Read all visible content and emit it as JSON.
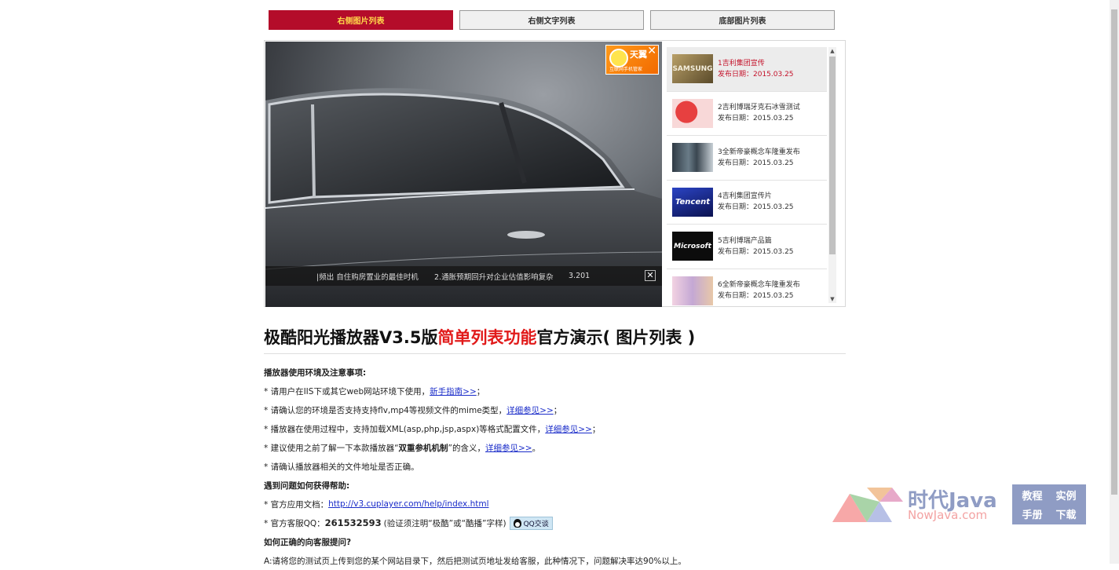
{
  "tabs": [
    {
      "label": "右侧图片列表",
      "active": true
    },
    {
      "label": "右侧文字列表",
      "active": false
    },
    {
      "label": "底部图片列表",
      "active": false
    }
  ],
  "ad": {
    "text": "天翼",
    "sub": "互联网手机管家",
    "close": "✕"
  },
  "ticker": {
    "items": [
      "|频出 自住购房置业的最佳时机",
      "2.通胀预期回升对企业估值影响复杂",
      "3.201"
    ],
    "close": "✕"
  },
  "playlist": [
    {
      "title": "1吉利集团宣传",
      "date": "发布日期：2015.03.25",
      "thumb_color": "#8a7a4a",
      "thumb_text": "SAMSUNG"
    },
    {
      "title": "2吉利博瑞牙克石冰雪测试",
      "date": "发布日期：2015.03.25",
      "thumb_color": "#e13c3c",
      "thumb_text": ""
    },
    {
      "title": "3全新帝豪概念车隆重发布",
      "date": "发布日期：2015.03.25",
      "thumb_color": "#3d4a52",
      "thumb_text": ""
    },
    {
      "title": "4吉利集团宣传片",
      "date": "发布日期：2015.03.25",
      "thumb_color": "#1d2f8a",
      "thumb_text": "Tencent"
    },
    {
      "title": "5吉利博瑞产品篇",
      "date": "发布日期：2015.03.25",
      "thumb_color": "#111111",
      "thumb_text": "Microsoft"
    },
    {
      "title": "6全新帝豪概念车隆重发布",
      "date": "发布日期：2015.03.25",
      "thumb_color": "#c4a8d4",
      "thumb_text": ""
    }
  ],
  "headline": {
    "part1": "极酷阳光播放器V3.5版",
    "part2": "简单列表功能",
    "part3": "官方演示( 图片列表 )"
  },
  "notes": {
    "env_title": "播放器使用环境及注意事项:",
    "l1_text": "* 请用户在IIS下或其它web网站环境下使用，",
    "l1_link": "新手指南>>",
    "l1_end": "；",
    "l2_text": "* 请确认您的环境是否支持支持flv,mp4等视频文件的mime类型，",
    "l2_link": "详细参见>>",
    "l2_end": "；",
    "l3_text": "* 播放器在使用过程中，支持加载XML(asp,php,jsp,aspx)等格式配置文件，",
    "l3_link": "详细参见>>",
    "l3_end": "；",
    "l4_text": "* 建议使用之前了解一下本款播放器“",
    "l4_bold": "双重参机机制",
    "l4_mid": "”的含义，",
    "l4_link": "详细参见>>",
    "l4_end": "。",
    "l5_text": "* 请确认播放器相关的文件地址是否正确。",
    "help_title": "遇到问题如何获得帮助:",
    "doc_text": "* 官方应用文档：",
    "doc_link": "http://v3.cuplayer.com/help/index.html",
    "qq_text": "* 官方客服QQ：",
    "qq_number": "261532593",
    "qq_note": "(验证须注明“极酷”或“酷播”字样)",
    "qq_button": "QQ交谈",
    "ask_title": "如何正确的向客服提问?",
    "ask_text": "A:请将您的测试页上传到您的某个网站目录下，然后把测试页地址发给客服，此种情况下，问题解决率达90%以上。"
  },
  "watermark": {
    "brand": "时代Java",
    "domain": "NowJava.com",
    "box": [
      "教程",
      "实例",
      "手册",
      "下载"
    ]
  }
}
